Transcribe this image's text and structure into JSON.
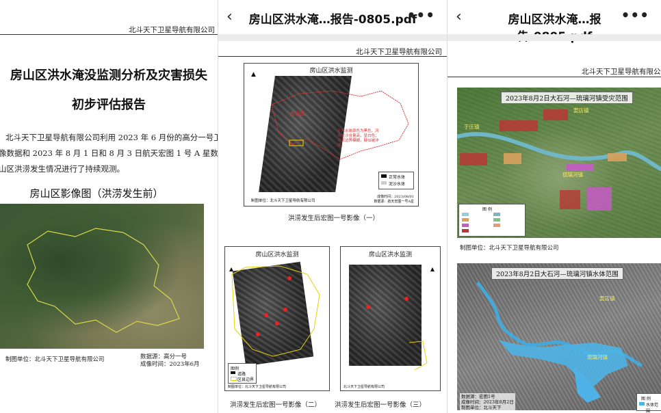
{
  "panel1": {
    "company": "北斗天下卫星导航有限公司",
    "title_line1": "房山区洪水淹没监测分析及灾害损失",
    "title_line2": "初步评估报告",
    "para_lines": [
      "北斗天下卫星导航有限公司利用 2023 年 6 月份的高分一号卫星",
      "像数据和 2023 年 8 月 1 日和 8 月 3 日航天宏图 1 号 A 星数据，对",
      "山区洪涝发生情况进行了持续观测。"
    ],
    "image_title": "房山区影像图（洪涝发生前）",
    "producer": "制图单位：北斗天下卫星导航有限公司",
    "data_source": "数据源：高分一号",
    "imaging_time": "成像时间：2023年6月"
  },
  "panel2": {
    "nav_back": "‹",
    "nav_title": "房山区洪水淹…报告-0805.pdf",
    "nav_more": "•••",
    "company": "北斗天下卫星导航有限公司",
    "map1_heading": "房山区洪水监测",
    "map1_annotation": "正常水体颜色为黑色，河流泥沙含量高，呈白色；河流边界模糊，疑似被冲毁。",
    "map1_place": "房山区",
    "map1_legend": [
      "正常水体",
      "泥沙水体"
    ],
    "map1_producer": "制图单位：北斗天下卫星导航有限公司",
    "map1_time": "成像时间：2023/08/01",
    "map1_source": "数据源：航天宏图一号A星",
    "caption1": "洪涝发生后宏图一号影像（一）",
    "map2_heading": "房山区洪水监测",
    "map3_heading": "房山区洪水监测",
    "map2_legend": [
      "图例",
      "道路",
      "区县边界"
    ],
    "map2_producer": "制图单位：北斗天下卫星导航有限公司",
    "map3_producer": "北斗天下卫星导航有限公司",
    "caption2": "洪涝发生后宏图一号影像（二）",
    "caption3": "洪涝发生后宏图一号影像（三）"
  },
  "panel3": {
    "nav_back": "‹",
    "nav_title": "房山区洪水淹…报告-0805.pdf",
    "nav_more": "•••",
    "company": "北斗天下卫星导航有限公司",
    "map1_title": "2023年8月2日大石河—琉璃河镇受灾范围",
    "map1_places": [
      "窦店镇",
      "于庄镇",
      "琉璃河镇"
    ],
    "map1_legend": [
      "图  例"
    ],
    "map1_producer": "制图单位：北斗天下卫星导航有限公司",
    "map2_title": "2023年8月2日大石河—琉璃河镇水体范围",
    "map2_places": [
      "窦店镇",
      "琉璃河镇"
    ],
    "map2_source": "数据源：宏图1号",
    "map2_time": "成像时间：2023年8月2日",
    "map2_producer": "制图单位：北斗天下",
    "map2_legend": [
      "图 例",
      "水体范围"
    ]
  }
}
